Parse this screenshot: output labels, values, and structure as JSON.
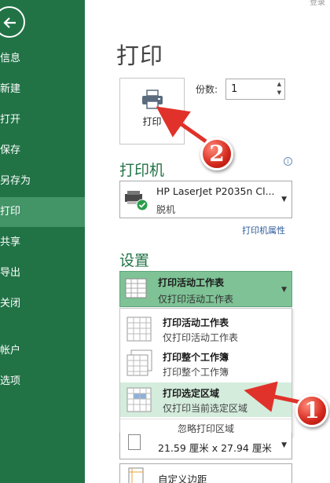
{
  "top_right_text": "登录",
  "sidebar": {
    "items": [
      {
        "label": "信息"
      },
      {
        "label": "新建"
      },
      {
        "label": "打开"
      },
      {
        "label": "保存"
      },
      {
        "label": "另存为"
      },
      {
        "label": "打印"
      },
      {
        "label": "共享"
      },
      {
        "label": "导出"
      },
      {
        "label": "关闭"
      },
      {
        "label": "帐户"
      },
      {
        "label": "选项"
      }
    ]
  },
  "main": {
    "title": "打印",
    "print_button_label": "打印",
    "copies_label": "份数:",
    "copies_value": "1",
    "printer_section_title": "打印机",
    "printer_name": "HP LaserJet P2035n Cl...",
    "printer_status": "脱机",
    "printer_properties_link": "打印机属性",
    "settings_section_title": "设置",
    "scope_selected_main": "打印活动工作表",
    "scope_selected_sub": "仅打印活动工作表",
    "scope_options": [
      {
        "title": "打印活动工作表",
        "desc": "仅打印活动工作表"
      },
      {
        "title": "打印整个工作簿",
        "desc": "打印整个工作簿"
      },
      {
        "title": "打印选定区域",
        "desc": "仅打印当前选定区域"
      }
    ],
    "ignore_print_area": "忽略打印区域",
    "paper_size": "21.59 厘米 x 27.94 厘米",
    "margins": "自定义边距"
  },
  "annotations": {
    "badge_1": "1",
    "badge_2": "2"
  },
  "colors": {
    "accent": "#217346",
    "sidebar_active": "#439467",
    "option_highlight": "#d4ecdc",
    "badge_red": "#d4281c"
  }
}
